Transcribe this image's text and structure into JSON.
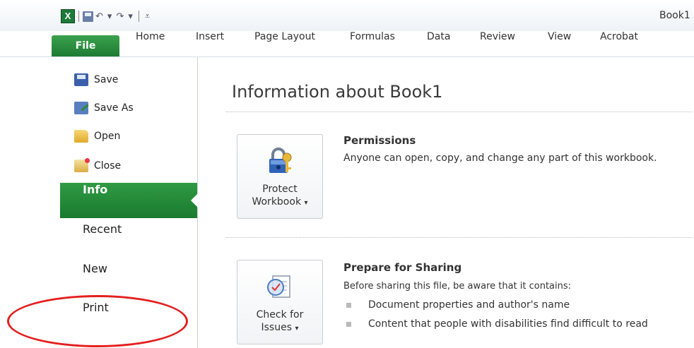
{
  "window": {
    "title": "Book1"
  },
  "ribbon": {
    "tabs": [
      "File",
      "Home",
      "Insert",
      "Page Layout",
      "Formulas",
      "Data",
      "Review",
      "View",
      "Acrobat"
    ]
  },
  "backstage": {
    "commands": [
      {
        "label": "Save",
        "icon": "save-icon"
      },
      {
        "label": "Save As",
        "icon": "save-as-icon"
      },
      {
        "label": "Open",
        "icon": "open-folder-icon"
      },
      {
        "label": "Close",
        "icon": "close-folder-icon"
      }
    ],
    "nav": [
      {
        "label": "Info",
        "active": true
      },
      {
        "label": "Recent",
        "active": false
      },
      {
        "label": "New",
        "active": false
      },
      {
        "label": "Print",
        "active": false
      }
    ]
  },
  "info": {
    "title": "Information about Book1",
    "permissions": {
      "button_line1": "Protect",
      "button_line2": "Workbook",
      "heading": "Permissions",
      "text": "Anyone can open, copy, and change any part of this workbook."
    },
    "sharing": {
      "button_line1": "Check for",
      "button_line2": "Issues",
      "heading": "Prepare for Sharing",
      "text": "Before sharing this file, be aware that it contains:",
      "bullets": [
        "Document properties and author's name",
        "Content that people with disabilities find difficult to read"
      ]
    }
  },
  "colors": {
    "accent_green": "#1e7b32",
    "annotation_red": "#e41f1f"
  }
}
